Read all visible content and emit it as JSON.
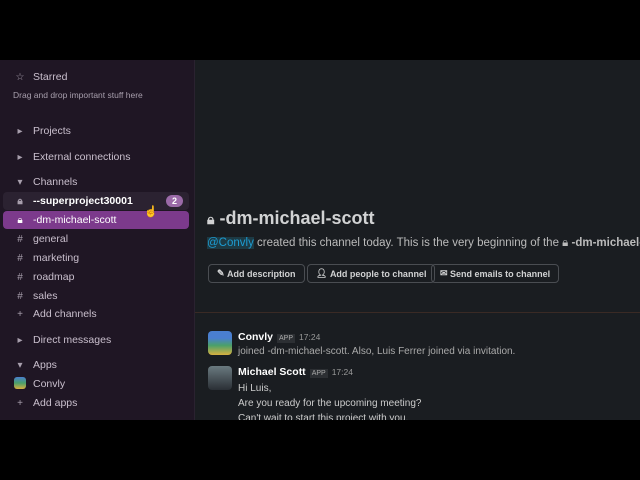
{
  "sidebar": {
    "starred": "Starred",
    "starred_hint": "Drag and drop important stuff here",
    "projects": "Projects",
    "external": "External connections",
    "channels": "Channels",
    "channel_items": [
      {
        "name": "--superproject30001",
        "badge": "2"
      },
      {
        "name": "-dm-michael-scott"
      },
      {
        "name": "general"
      },
      {
        "name": "marketing"
      },
      {
        "name": "roadmap"
      },
      {
        "name": "sales"
      }
    ],
    "add_channels": "Add channels",
    "direct_messages": "Direct messages",
    "apps": "Apps",
    "convly": "Convly",
    "add_apps": "Add apps"
  },
  "main": {
    "channel_title": "-dm-michael-scott",
    "mention": "@Convly",
    "intro": " created this channel today. This is the very beginning of the ",
    "intro_channel": "-dm-michael-scott",
    "buttons": [
      "Add description",
      "Add people to channel",
      "Send emails to channel"
    ],
    "messages": [
      {
        "author": "Convly",
        "tag": "APP",
        "time": "17:24",
        "lines": [
          "joined -dm-michael-scott. Also, Luis Ferrer joined via invitation."
        ]
      },
      {
        "author": "Michael Scott",
        "tag": "APP",
        "time": "17:24",
        "lines": [
          "Hi Luis,",
          "Are you ready for the upcoming meeting?",
          "Can't wait to start this project with you."
        ]
      }
    ]
  }
}
